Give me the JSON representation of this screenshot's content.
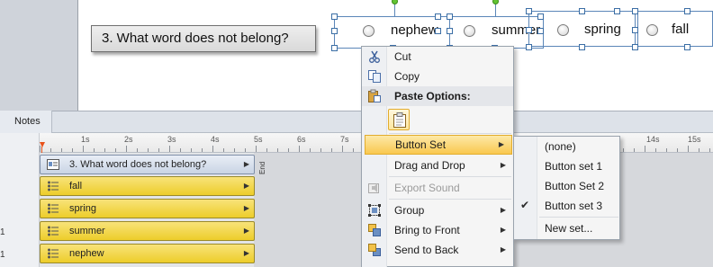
{
  "slide": {
    "question": "3. What word does not belong?",
    "answers": [
      "nephew",
      "summer",
      "spring",
      "fall"
    ]
  },
  "timeline": {
    "notes_tab": "Notes",
    "end_label": "End",
    "ruler_labels": [
      "1s",
      "2s",
      "3s",
      "4s",
      "5s",
      "6s",
      "7s",
      "14s",
      "15s"
    ],
    "rows": [
      {
        "label": "3. What word does not belong?",
        "kind": "question"
      },
      {
        "label": "fall",
        "kind": "button"
      },
      {
        "label": "spring",
        "kind": "button"
      },
      {
        "label": "summer",
        "kind": "button"
      },
      {
        "label": "nephew",
        "kind": "button"
      }
    ],
    "row_numbers": [
      "1",
      "1"
    ]
  },
  "context_menu": {
    "cut": "Cut",
    "copy": "Copy",
    "paste_options": "Paste Options:",
    "button_set": "Button Set",
    "drag_and_drop": "Drag and Drop",
    "export_sound": "Export Sound",
    "group": "Group",
    "bring_to_front": "Bring to Front",
    "send_to_back": "Send to Back"
  },
  "button_set_submenu": {
    "items": [
      "(none)",
      "Button set 1",
      "Button Set 2",
      "Button set 3",
      "New set..."
    ],
    "checked": "Button set 3"
  },
  "colors": {
    "highlight": "#f9c84f",
    "timeline_item": "#edcd2a",
    "selection": "#5b86b8",
    "playhead": "#e8521a"
  }
}
